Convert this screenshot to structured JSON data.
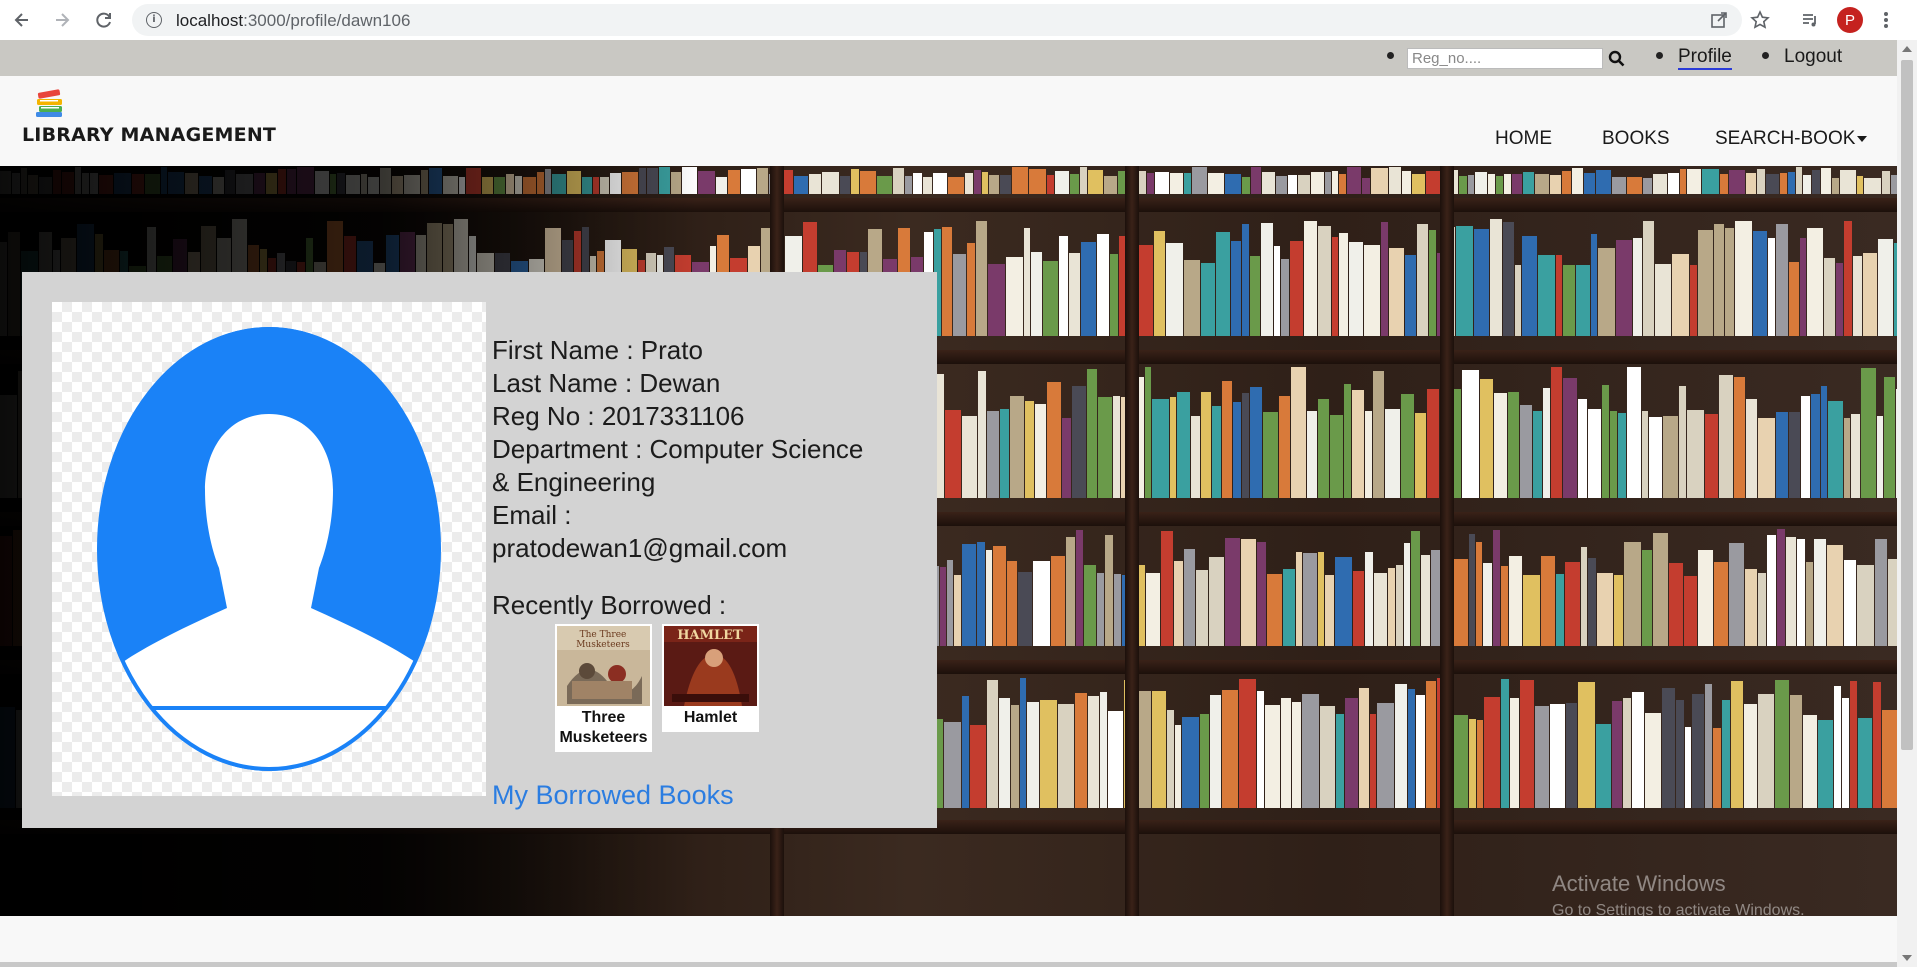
{
  "browser": {
    "url_host": "localhost",
    "url_path": ":3000/profile/dawn106",
    "profile_initial": "P",
    "icons": [
      "back-icon",
      "forward-icon",
      "reload-icon",
      "site-info-icon",
      "share-icon",
      "bookmark-star-icon",
      "reading-list-icon",
      "more-icon"
    ]
  },
  "topbar": {
    "search_placeholder": "Reg_no....",
    "search_icon": "search-icon",
    "profile_label": "Profile",
    "logout_label": "Logout"
  },
  "header": {
    "brand": "LIBRARY MANAGEMENT",
    "logo_icon": "books-stack-icon",
    "nav": {
      "home": "HOME",
      "books": "BOOKS",
      "search_book": "SEARCH-BOOK"
    }
  },
  "profile": {
    "first_name_line": "First Name : Prato",
    "last_name_line": "Last Name : Dewan",
    "reg_line": "Reg No : 2017331106",
    "department_line1": "Department : Computer Science",
    "department_line2": "& Engineering",
    "email_label": "Email :",
    "email_value": "pratodewan1@gmail.com",
    "recent_title": "Recently Borrowed :",
    "recent_books": [
      {
        "title_line1": "Three",
        "title_line2": "Musketeers"
      },
      {
        "title_line1": "Hamlet",
        "title_line2": ""
      }
    ],
    "borrowed_link": "My Borrowed Books"
  },
  "colors": {
    "accent_link": "#2b7de1",
    "avatar_blue": "#1a82f7",
    "card_bg": "#d3d3d3",
    "topstrip_bg": "#c9c8c3"
  },
  "watermark": {
    "line1": "Activate Windows",
    "line2": "Go to Settings to activate Windows."
  }
}
